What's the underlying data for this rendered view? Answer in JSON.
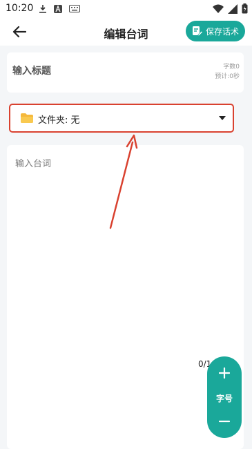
{
  "status_bar": {
    "time": "10:20",
    "icons": [
      "download-icon",
      "font-app-icon",
      "keyboard-icon",
      "wifi-icon",
      "signal-icon",
      "battery-icon"
    ]
  },
  "header": {
    "title": "编辑台词",
    "save_label": "保存话术"
  },
  "title_card": {
    "placeholder": "输入标题",
    "char_count": "字数0",
    "estimated_time": "预计:0秒"
  },
  "folder": {
    "label": "文件夹:  无"
  },
  "content": {
    "placeholder": "输入台词",
    "counter": "0/1"
  },
  "font_size_panel": {
    "plus": "+",
    "label": "字号",
    "minus": "−"
  },
  "colors": {
    "accent": "#1aa89a",
    "annotation": "#d9412f",
    "folder": "#f5b83b"
  }
}
